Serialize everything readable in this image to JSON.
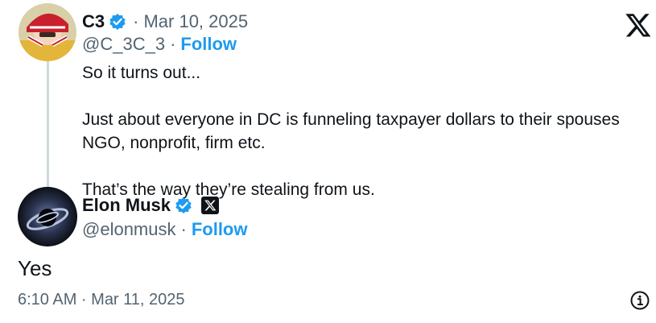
{
  "quoted_tweet": {
    "author_name": "C3",
    "separator": "·",
    "date": "Mar 10, 2025",
    "handle": "@C_3C_3",
    "handle_sep": "·",
    "follow_label": "Follow",
    "text_lines": [
      "So it turns out...",
      "Just about everyone in DC is funneling taxpayer dollars to their spouses NGO, nonprofit, firm etc.",
      "That’s the way they’re stealing from us."
    ]
  },
  "reply_tweet": {
    "author_name": "Elon Musk",
    "handle": "@elonmusk",
    "handle_sep": "·",
    "follow_label": "Follow",
    "text": "Yes",
    "timestamp": "6:10 AM · Mar 11, 2025"
  },
  "icons": {
    "x_logo": "x-logo-icon",
    "verified": "verified-badge-icon",
    "affiliate": "x-affiliate-badge-icon",
    "info": "info-icon"
  },
  "colors": {
    "accent": "#1d9bf0",
    "text_primary": "#0f1419",
    "text_secondary": "#536471",
    "thread_line": "#cfd9de"
  }
}
